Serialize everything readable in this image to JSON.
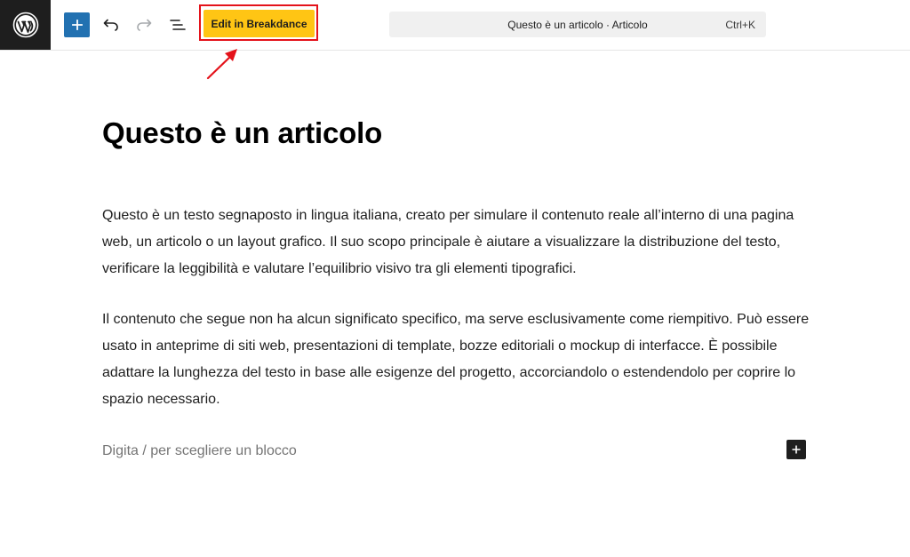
{
  "toolbar": {
    "logo_icon": "wordpress-logo",
    "add_icon": "plus-icon",
    "undo_icon": "undo-icon",
    "redo_icon": "redo-icon",
    "outline_icon": "list-view-icon",
    "breakdance_label": "Edit in Breakdance",
    "command_title": "Questo è un articolo · Articolo",
    "command_shortcut": "Ctrl+K"
  },
  "post": {
    "title": "Questo è un articolo",
    "paragraphs": [
      "Questo è un testo segnaposto in lingua italiana, creato per simulare il contenuto reale all’interno di una pagina web, un articolo o un layout grafico. Il suo scopo principale è aiutare a visualizzare la distribuzione del testo, verificare la leggibilità e valutare l’equilibrio visivo tra gli elementi tipografici.",
      "Il contenuto che segue non ha alcun significato specifico, ma serve esclusivamente come riempitivo. Può essere usato in anteprime di siti web, presentazioni di template, bozze editoriali o mockup di interfacce. È possibile adattare la lunghezza del testo in base alle esigenze del progetto, accorciandolo o estendendolo per coprire lo spazio necessario."
    ],
    "block_placeholder": "Digita / per scegliere un blocco"
  },
  "colors": {
    "accent": "#2271b1",
    "breakdance": "#ffc514",
    "annotation": "#e4121a",
    "logo_bg": "#1e1e1e"
  }
}
